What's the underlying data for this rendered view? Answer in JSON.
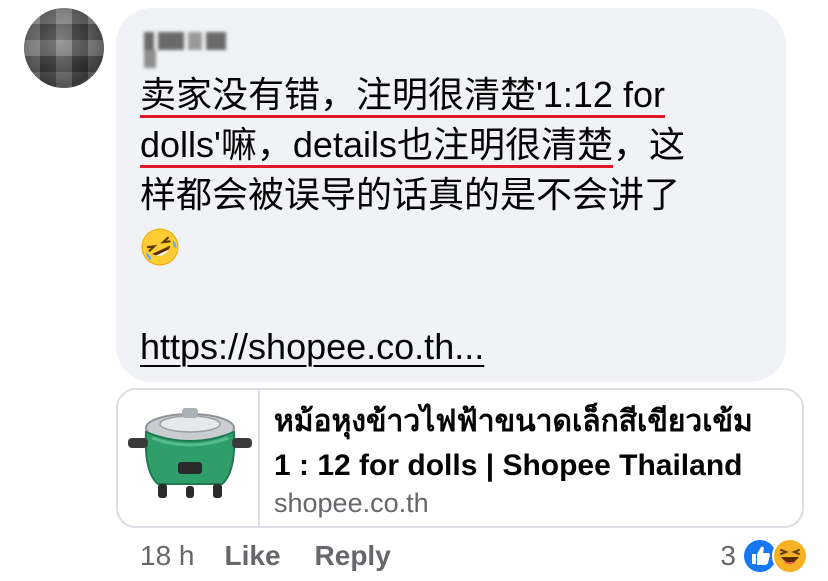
{
  "comment": {
    "author_name": "L...",
    "text_lines": [
      {
        "pre": "",
        "underlined": "卖家没有错，注明很清楚'1:12 for",
        "post": ""
      },
      {
        "pre": "",
        "underlined": "dolls'嘛，details也注明很清楚",
        "post": "，这"
      },
      {
        "pre": "",
        "underlined": "",
        "post": "样都会被误导的话真的是不会讲了"
      }
    ],
    "emoji_icon": "rofl-emoji-icon",
    "link_text": "https://shopee.co.th..."
  },
  "preview": {
    "title_lines": [
      "หม้อหุงข้าวไฟฟ้าขนาดเล็กสีเขียวเข้ม",
      "1 : 12 for dolls | Shopee Thailand"
    ],
    "domain": "shopee.co.th",
    "thumbnail_icon": "rice-cooker-icon"
  },
  "actions": {
    "time": "18 h",
    "like_label": "Like",
    "reply_label": "Reply"
  },
  "reactions": {
    "count": "3",
    "icons": [
      "like-reaction-icon",
      "haha-reaction-icon"
    ]
  },
  "colors": {
    "bubble_bg": "#f0f2f5",
    "underline": "#e0182a",
    "muted": "#65676b",
    "like_blue": "#1877f2"
  }
}
